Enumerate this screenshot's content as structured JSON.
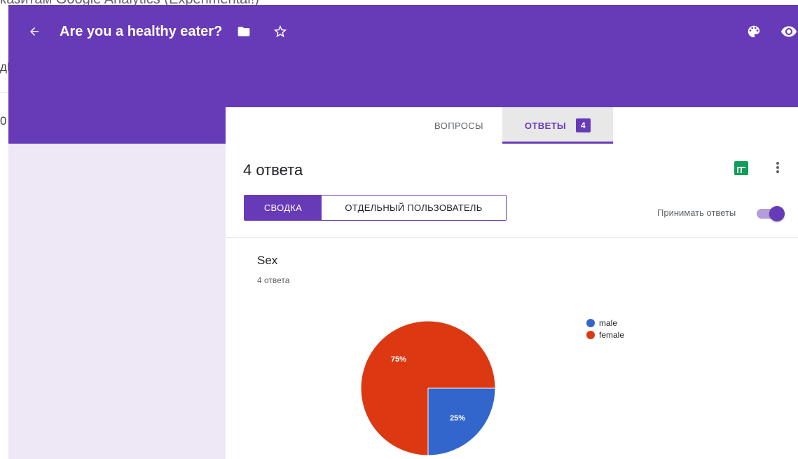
{
  "background": {
    "title_fragment": "казитам Google Analytics (Experimental!)",
    "frag_1": "дЕ",
    "frag_2": "0"
  },
  "header": {
    "title": "Are you a healthy eater?",
    "icons": [
      "back-arrow-icon",
      "folder-icon",
      "star-icon",
      "palette-icon",
      "eye-icon"
    ],
    "color": "#673ab7"
  },
  "tabs": [
    {
      "label": "ВОПРОСЫ"
    },
    {
      "label": "ОТВЕТЫ",
      "badge": "4",
      "active": true
    }
  ],
  "summary": {
    "count_title": "4 ответа",
    "view_summary": "СВОДКА",
    "view_individual": "ОТДЕЛЬНЫЙ ПОЛЬЗОВАТЕЛЬ",
    "accept_label": "Принимать ответы",
    "accepting": true
  },
  "question": {
    "title": "Sex",
    "count": "4 ответа"
  },
  "chart_data": {
    "type": "pie",
    "categories": [
      "male",
      "female"
    ],
    "values": [
      25,
      75
    ],
    "labels": [
      "25%",
      "75%"
    ],
    "colors": [
      "#3366cc",
      "#dc3912"
    ],
    "legend_position": "right"
  }
}
